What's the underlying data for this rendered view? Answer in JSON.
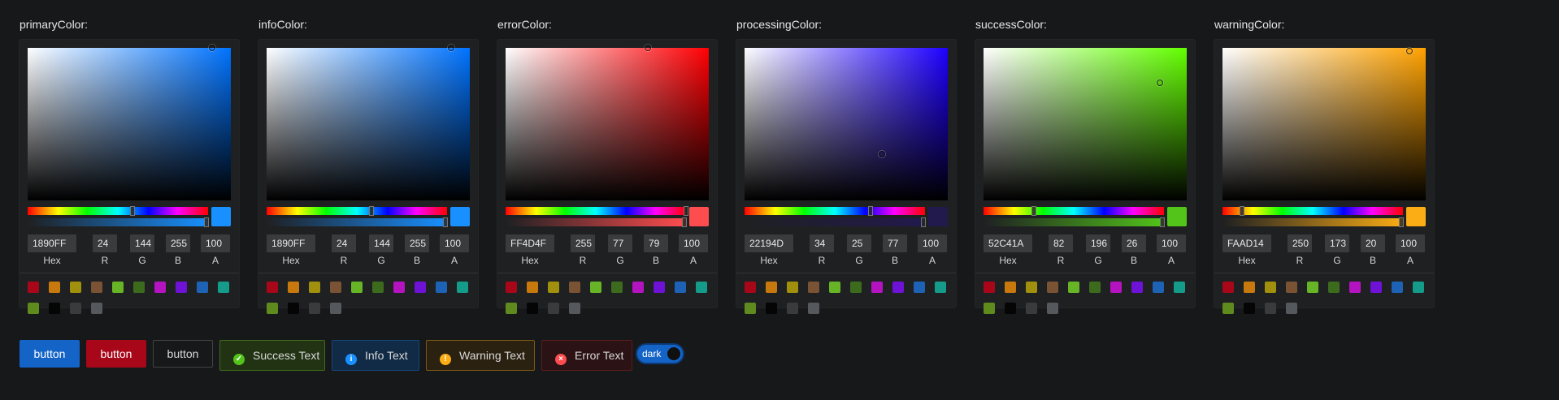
{
  "pickers": [
    {
      "label": "primaryColor:",
      "hue": "#0073ff",
      "color": "#1890ff",
      "sat_x": 0.906,
      "sat_y": 0.0,
      "hue_pos": 0.583,
      "alpha_pos": 1.0,
      "hex": "1890FF",
      "r": "24",
      "g": "144",
      "b": "255",
      "a": "100"
    },
    {
      "label": "infoColor:",
      "hue": "#0073ff",
      "color": "#1890ff",
      "sat_x": 0.906,
      "sat_y": 0.0,
      "hue_pos": 0.583,
      "alpha_pos": 1.0,
      "hex": "1890FF",
      "r": "24",
      "g": "144",
      "b": "255",
      "a": "100"
    },
    {
      "label": "errorColor:",
      "hue": "#ff0004",
      "color": "#ff4d4f",
      "sat_x": 0.698,
      "sat_y": 0.0,
      "hue_pos": 0.999,
      "alpha_pos": 1.0,
      "hex": "FF4D4F",
      "r": "255",
      "g": "77",
      "b": "79",
      "a": "100"
    },
    {
      "label": "processingColor:",
      "hue": "#1e00ff",
      "color": "#22194d",
      "sat_x": 0.675,
      "sat_y": 0.698,
      "hue_pos": 0.697,
      "alpha_pos": 1.0,
      "hex": "22194D",
      "r": "34",
      "g": "25",
      "b": "77",
      "a": "100"
    },
    {
      "label": "successColor:",
      "hue": "#63ff00",
      "color": "#52c41a",
      "sat_x": 0.867,
      "sat_y": 0.231,
      "hue_pos": 0.28,
      "alpha_pos": 1.0,
      "hex": "52C41A",
      "r": "82",
      "g": "196",
      "b": "26",
      "a": "100"
    },
    {
      "label": "warningColor:",
      "hue": "#ffa200",
      "color": "#faad14",
      "sat_x": 0.92,
      "sat_y": 0.019,
      "hue_pos": 0.11,
      "alpha_pos": 1.0,
      "hex": "FAAD14",
      "r": "250",
      "g": "173",
      "b": "20",
      "a": "100"
    }
  ],
  "caption_labels": {
    "hex": "Hex",
    "r": "R",
    "g": "G",
    "b": "B",
    "a": "A"
  },
  "preset_colors": [
    "#a8071a",
    "#c7790e",
    "#a0900d",
    "#7a5234",
    "#67b527",
    "#3d6b1e",
    "#b314c0",
    "#6e12d6",
    "#1d62b5",
    "#159b8a",
    "#5f8a1e",
    "#050505",
    "#3a3b3d",
    "#55595e"
  ],
  "buttons": {
    "primary": "button",
    "danger": "button",
    "default": "button"
  },
  "tags": {
    "success": "Success Text",
    "info": "Info Text",
    "warning": "Warning Text",
    "error": "Error Text"
  },
  "tag_icons": {
    "success": "✓",
    "info": "i",
    "warning": "!",
    "error": "×"
  },
  "theme_switch": {
    "label": "dark"
  },
  "colors": {
    "primary": "#1464c8",
    "danger": "#a8071a",
    "success_bg": "#223314",
    "success_border": "#3f6b1e",
    "success_icon": "#52c41a",
    "info_bg": "#112a45",
    "info_border": "#15467a",
    "info_icon": "#1890ff",
    "warning_bg": "#2b2111",
    "warning_border": "#7c5914",
    "warning_icon": "#faad14",
    "error_bg": "#2a1215",
    "error_border": "#5c1b1f",
    "error_icon": "#ff4d4f"
  }
}
